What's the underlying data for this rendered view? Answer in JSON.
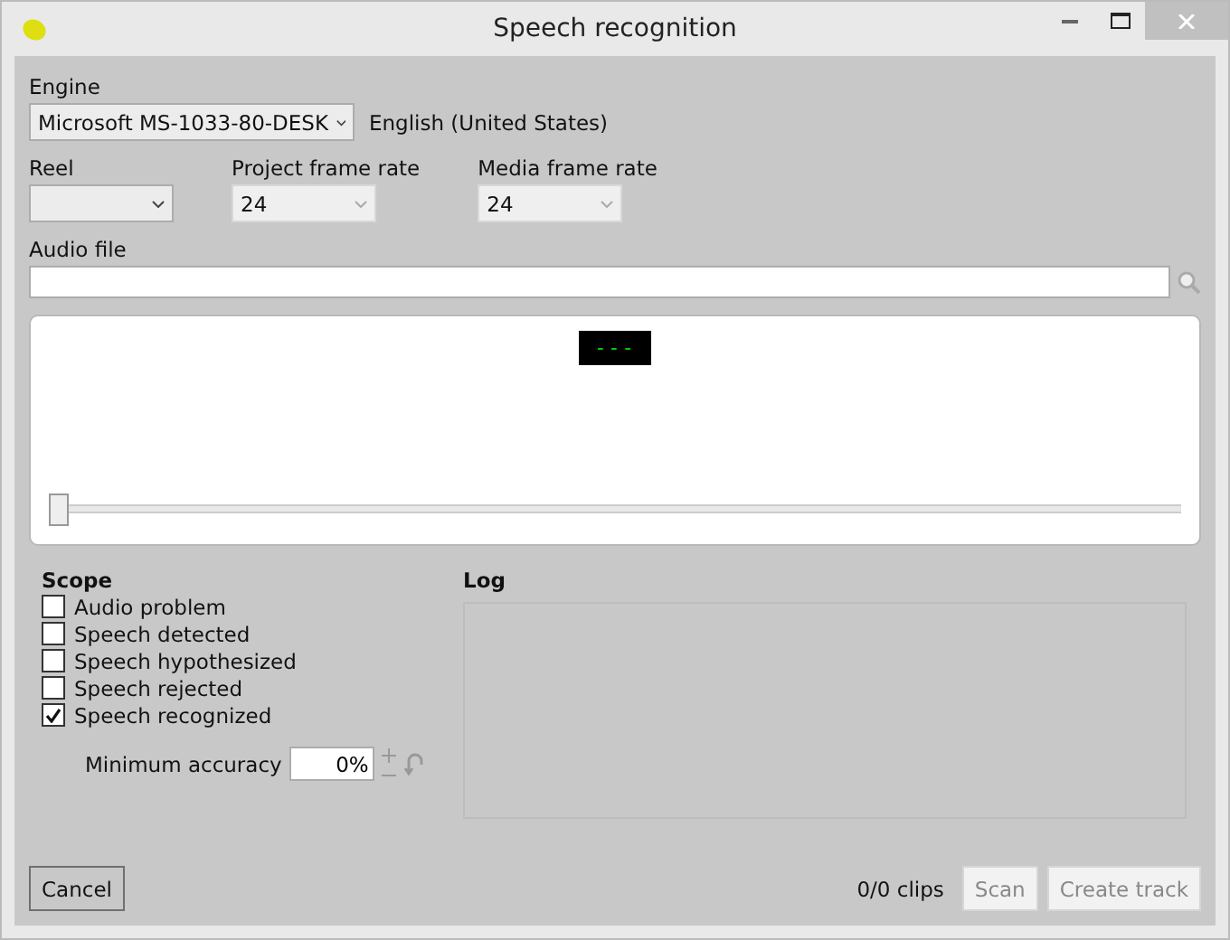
{
  "window": {
    "title": "Speech recognition"
  },
  "engine": {
    "label": "Engine",
    "value": "Microsoft MS-1033-80-DESK",
    "language": "English (United States)"
  },
  "selects": [
    {
      "label": "Reel",
      "disabled": false
    },
    {
      "label": "Project frame rate",
      "value": "24",
      "disabled": true
    },
    {
      "label": "Media frame rate",
      "value": "24",
      "disabled": true
    }
  ],
  "audio_file": {
    "label": "Audio file"
  },
  "player": {
    "timecode": "---",
    "position": {
      "level": 0
    }
  },
  "scope": {
    "title": "Scope",
    "items": [
      {
        "label": "Audio problem",
        "checked": false
      },
      {
        "label": "Speech detected",
        "checked": false
      },
      {
        "label": "Speech hypothesized",
        "checked": false
      },
      {
        "label": "Speech rejected",
        "checked": false
      },
      {
        "label": "Speech recognized",
        "checked": true
      }
    ],
    "min_accuracy": {
      "label": "Minimum accuracy",
      "value": "0%"
    }
  },
  "log": {
    "title": "Log"
  },
  "footer": {
    "cancel": "Cancel",
    "count": "0/0 clips",
    "scan": {
      "label": "Scan",
      "disabled": true
    },
    "create": {
      "label": "Create track",
      "disabled": true
    }
  }
}
